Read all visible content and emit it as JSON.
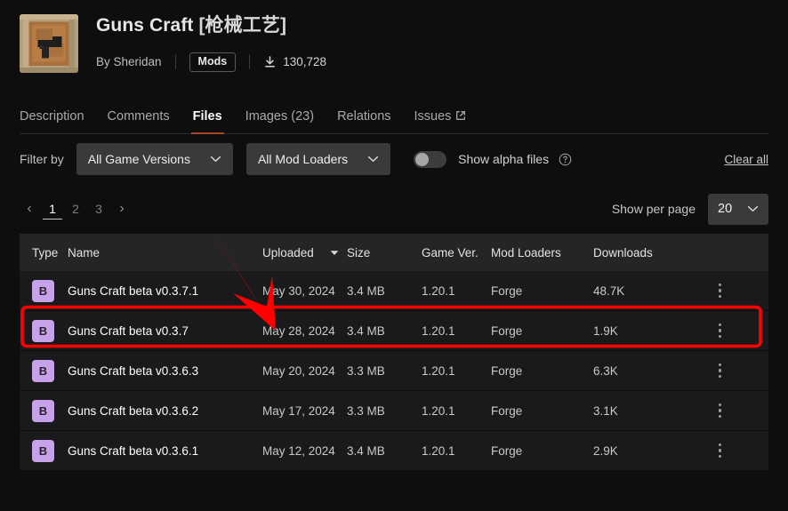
{
  "project": {
    "title_main": "Guns Craft ",
    "title_alt": "[枪械工艺]",
    "author": "By Sheridan",
    "category_badge": "Mods",
    "downloads": "130,728",
    "thumbnail_icon": "pistol-in-wooden-frame-icon"
  },
  "tabs": [
    {
      "label": "Description",
      "active": false,
      "external": false
    },
    {
      "label": "Comments",
      "active": false,
      "external": false
    },
    {
      "label": "Files",
      "active": true,
      "external": false
    },
    {
      "label": "Images (23)",
      "active": false,
      "external": false
    },
    {
      "label": "Relations",
      "active": false,
      "external": false
    },
    {
      "label": "Issues",
      "active": false,
      "external": true
    }
  ],
  "filters": {
    "label": "Filter by",
    "game_versions": "All Game Versions",
    "mod_loaders": "All Mod Loaders",
    "show_alpha_label": "Show alpha files",
    "show_alpha_enabled": false,
    "help_icon": "question-mark-circle-icon",
    "clear_all": "Clear all"
  },
  "pagination": {
    "prev": "‹",
    "next": "›",
    "pages": [
      "1",
      "2",
      "3"
    ],
    "active_page": "1",
    "per_page_label": "Show per page",
    "per_page_value": "20"
  },
  "table": {
    "columns": [
      "Type",
      "Name",
      "Uploaded",
      "Size",
      "Game Ver.",
      "Mod Loaders",
      "Downloads"
    ],
    "sort_column": "Uploaded",
    "sort_direction": "desc",
    "rows": [
      {
        "type": "B",
        "name": "Guns Craft beta v0.3.7.1",
        "uploaded": "May 30, 2024",
        "size": "3.4 MB",
        "game_ver": "1.20.1",
        "mod_loaders": "Forge",
        "downloads": "48.7K",
        "highlighted": true
      },
      {
        "type": "B",
        "name": "Guns Craft beta v0.3.7",
        "uploaded": "May 28, 2024",
        "size": "3.4 MB",
        "game_ver": "1.20.1",
        "mod_loaders": "Forge",
        "downloads": "1.9K",
        "highlighted": false
      },
      {
        "type": "B",
        "name": "Guns Craft beta v0.3.6.3",
        "uploaded": "May 20, 2024",
        "size": "3.3 MB",
        "game_ver": "1.20.1",
        "mod_loaders": "Forge",
        "downloads": "6.3K",
        "highlighted": false
      },
      {
        "type": "B",
        "name": "Guns Craft beta v0.3.6.2",
        "uploaded": "May 17, 2024",
        "size": "3.3 MB",
        "game_ver": "1.20.1",
        "mod_loaders": "Forge",
        "downloads": "3.1K",
        "highlighted": false
      },
      {
        "type": "B",
        "name": "Guns Craft beta v0.3.6.1",
        "uploaded": "May 12, 2024",
        "size": "3.4 MB",
        "game_ver": "1.20.1",
        "mod_loaders": "Forge",
        "downloads": "2.9K",
        "highlighted": false
      }
    ]
  },
  "annotations": {
    "arrow_color": "#fe0000",
    "highlight_box_color": "#fe0000",
    "accent_color": "#a8462c",
    "badge_color": "#c6a2e8"
  }
}
